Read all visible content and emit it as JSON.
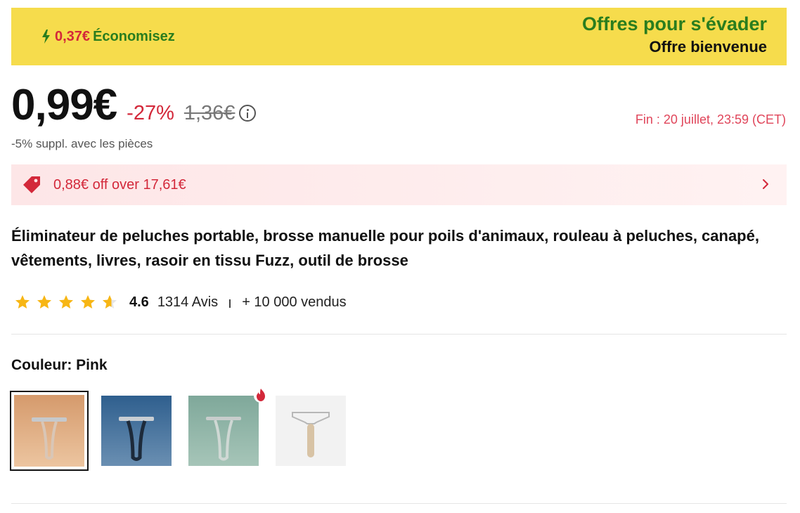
{
  "banner": {
    "save_amount": "0,37€",
    "save_label": "Économisez",
    "offer_title": "Offres pour s'évader",
    "offer_subtitle": "Offre bienvenue"
  },
  "price": {
    "current": "0,99€",
    "discount": "-27%",
    "original": "1,36€",
    "extra": "-5% suppl. avec les pièces",
    "end_time": "Fin :  20 juillet, 23:59 (CET)"
  },
  "coupon": {
    "text": "0,88€ off over 17,61€"
  },
  "product": {
    "title": "Éliminateur de peluches portable, brosse manuelle pour poils d'animaux, rouleau à peluches, canapé, vêtements, livres, rasoir en tissu Fuzz, outil de brosse"
  },
  "rating": {
    "value": "4.6",
    "stars": 4.6,
    "reviews": "1314 Avis",
    "sold": "+ 10 000 vendus"
  },
  "color": {
    "label": "Couleur: Pink",
    "options": [
      {
        "name": "Pink",
        "selected": true
      },
      {
        "name": "Blue",
        "selected": false
      },
      {
        "name": "Green",
        "selected": false,
        "hot": true
      },
      {
        "name": "Wood",
        "selected": false
      }
    ]
  },
  "colors": {
    "accent_red": "#d3283a",
    "banner_yellow": "#f6dc4c",
    "banner_green": "#2a7d1e",
    "star": "#f7b614"
  }
}
